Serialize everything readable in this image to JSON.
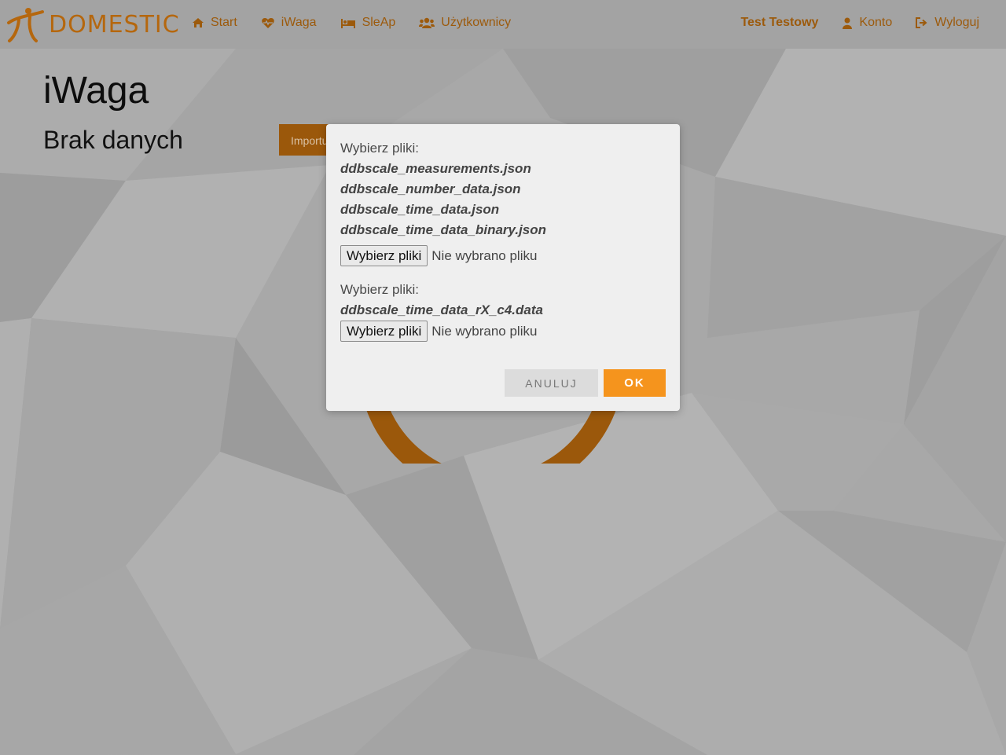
{
  "brand": {
    "name": "DOMESTIC",
    "logo_icon": "pi-figure-icon"
  },
  "nav": {
    "left": [
      {
        "label": "Start",
        "icon": "home-icon"
      },
      {
        "label": "iWaga",
        "icon": "heartbeat-icon"
      },
      {
        "label": "SleAp",
        "icon": "bed-icon"
      },
      {
        "label": "Użytkownicy",
        "icon": "users-icon"
      }
    ],
    "user_name": "Test Testowy",
    "account": {
      "label": "Konto",
      "icon": "user-icon"
    },
    "logout": {
      "label": "Wyloguj",
      "icon": "sign-out-icon"
    }
  },
  "page": {
    "title": "iWaga",
    "status": "Brak danych",
    "import_button": "Importuj"
  },
  "modal": {
    "group1": {
      "label": "Wybierz pliki:",
      "files": [
        "ddbscale_measurements.json",
        "ddbscale_number_data.json",
        "ddbscale_time_data.json",
        "ddbscale_time_data_binary.json"
      ],
      "button": "Wybierz pliki",
      "status": "Nie wybrano pliku"
    },
    "group2": {
      "label": "Wybierz pliki:",
      "files": [
        "ddbscale_time_data_rX_c4.data"
      ],
      "button": "Wybierz pliki",
      "status": "Nie wybrano pliku"
    },
    "cancel_label": "ANULUJ",
    "ok_label": "OK"
  },
  "colors": {
    "accent": "#9b580b",
    "ok_button": "#f5941d",
    "backdrop": "#a9a9a9"
  }
}
